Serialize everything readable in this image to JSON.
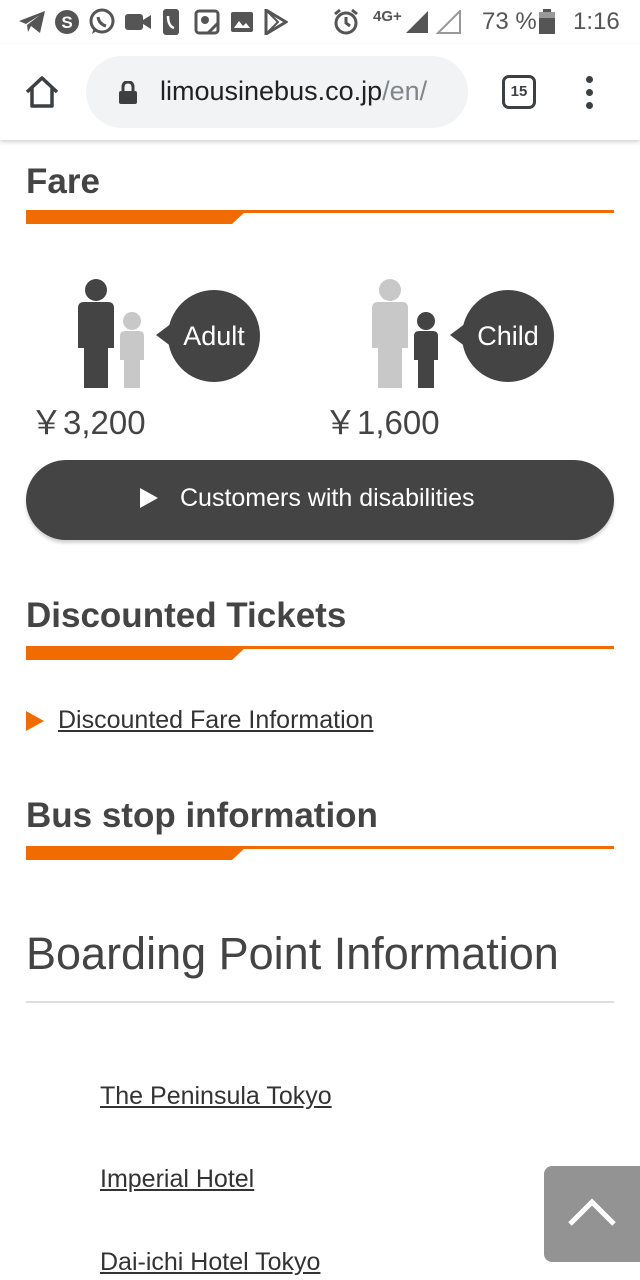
{
  "status_bar": {
    "network": "4G+",
    "battery": "73 %",
    "time": "1:16",
    "icons": [
      "telegram-icon",
      "skype-icon",
      "whatsapp-icon",
      "video-call-icon",
      "phone-icon",
      "location-icon",
      "image-icon",
      "play-store-icon",
      "alarm-icon",
      "signal-icon",
      "battery-icon"
    ]
  },
  "browser": {
    "url_domain": "limousinebus.co.jp",
    "url_path": "/en/",
    "tab_count": "15",
    "icons": [
      "home-icon",
      "lock-icon",
      "tabs-icon",
      "more-vert-icon"
    ]
  },
  "fare": {
    "title": "Fare",
    "adult_label": "Adult",
    "adult_price": "￥3,200",
    "child_label": "Child",
    "child_price": "￥1,600",
    "disabilities_button": "Customers with disabilities"
  },
  "discounted": {
    "title": "Discounted Tickets",
    "link": "Discounted Fare Information"
  },
  "bus_stop": {
    "title": "Bus stop information",
    "boarding_heading": "Boarding Point Information",
    "stops": [
      "The Peninsula Tokyo",
      "Imperial Hotel",
      "Dai-ichi Hotel Tokyo"
    ]
  },
  "colors": {
    "accent": "#f26b00",
    "dark": "#444444",
    "figure_light": "#c8c8c8"
  }
}
